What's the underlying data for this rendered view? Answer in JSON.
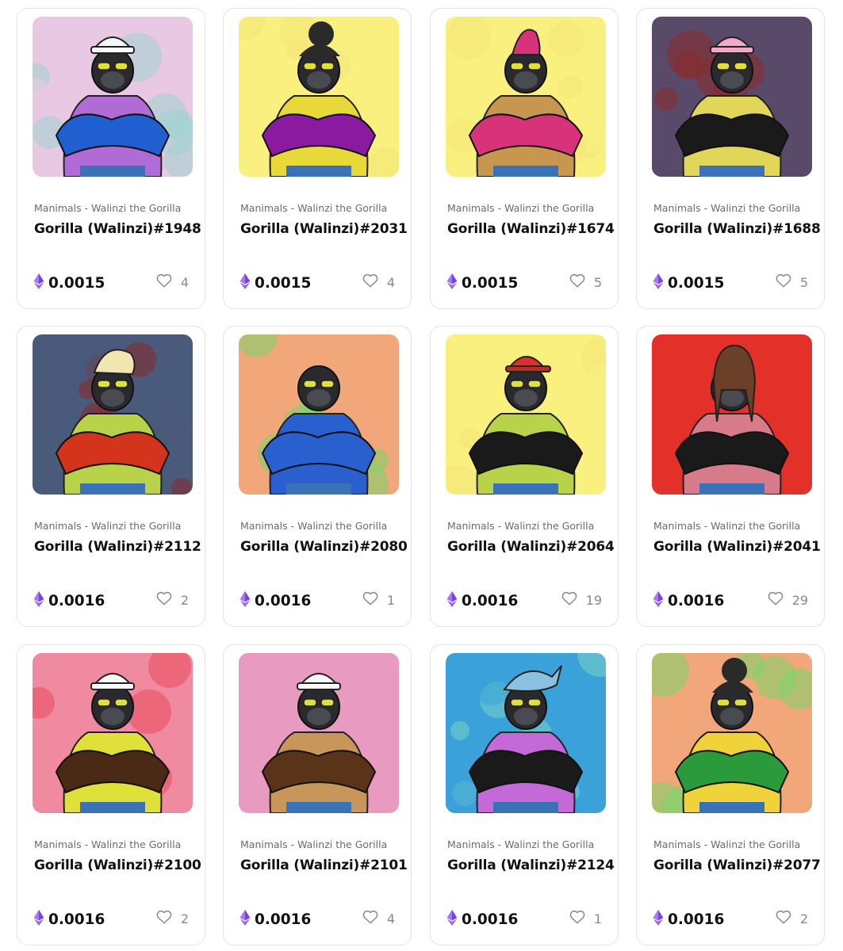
{
  "eth_color": "#7b3fe4",
  "items": [
    {
      "collection": "Manimals - Walinzi the Gorilla",
      "name": "Gorilla (Walinzi)#1948",
      "price": "0.0015",
      "likes": "4",
      "bg": "#e9c8e4",
      "bg2": "#9fd3d0",
      "fur": "#1f5fcf",
      "accent": "#b06bd6",
      "hat": "sailor"
    },
    {
      "collection": "Manimals - Walinzi the Gorilla",
      "name": "Gorilla (Walinzi)#2031",
      "price": "0.0015",
      "likes": "4",
      "bg": "#f9f07f",
      "bg2": "#f4e678",
      "fur": "#8a1aa0",
      "accent": "#e8d83a",
      "hat": "bun"
    },
    {
      "collection": "Manimals - Walinzi the Gorilla",
      "name": "Gorilla (Walinzi)#1674",
      "price": "0.0015",
      "likes": "5",
      "bg": "#f9f07f",
      "bg2": "#f4e678",
      "fur": "#d8327a",
      "accent": "#c8964e",
      "hat": "mohawk"
    },
    {
      "collection": "Manimals - Walinzi the Gorilla",
      "name": "Gorilla (Walinzi)#1688",
      "price": "0.0015",
      "likes": "5",
      "bg": "#5a4a6a",
      "bg2": "#8a2a2a",
      "fur": "#1a1a1a",
      "accent": "#e1d65a",
      "hat": "sailor-pink"
    },
    {
      "collection": "Manimals - Walinzi the Gorilla",
      "name": "Gorilla (Walinzi)#2112",
      "price": "0.0016",
      "likes": "2",
      "bg": "#4a5a7a",
      "bg2": "#8a2a2a",
      "fur": "#d4341c",
      "accent": "#b8d24a",
      "hat": "blond"
    },
    {
      "collection": "Manimals - Walinzi the Gorilla",
      "name": "Gorilla (Walinzi)#2080",
      "price": "0.0016",
      "likes": "1",
      "bg": "#f1a77a",
      "bg2": "#7ad66a",
      "fur": "#2a5fcf",
      "accent": "#2a5fcf",
      "hat": "none"
    },
    {
      "collection": "Manimals - Walinzi the Gorilla",
      "name": "Gorilla (Walinzi)#2064",
      "price": "0.0016",
      "likes": "19",
      "bg": "#f9f07f",
      "bg2": "#f4e678",
      "fur": "#1a1a1a",
      "accent": "#b8d24a",
      "hat": "cap"
    },
    {
      "collection": "Manimals - Walinzi the Gorilla",
      "name": "Gorilla (Walinzi)#2041",
      "price": "0.0016",
      "likes": "29",
      "bg": "#e3312a",
      "bg2": "#e3312a",
      "fur": "#1a1a1a",
      "accent": "#d77a8a",
      "hat": "long"
    },
    {
      "collection": "Manimals - Walinzi the Gorilla",
      "name": "Gorilla (Walinzi)#2100",
      "price": "0.0016",
      "likes": "2",
      "bg": "#f08aa0",
      "bg2": "#ea4a5a",
      "fur": "#4a2a14",
      "accent": "#e0e03a",
      "hat": "sailor"
    },
    {
      "collection": "Manimals - Walinzi the Gorilla",
      "name": "Gorilla (Walinzi)#2101",
      "price": "0.0016",
      "likes": "4",
      "bg": "#e89ac0",
      "bg2": "#e89ac0",
      "fur": "#5a3418",
      "accent": "#c8965a",
      "hat": "sailor"
    },
    {
      "collection": "Manimals - Walinzi the Gorilla",
      "name": "Gorilla (Walinzi)#2124",
      "price": "0.0016",
      "likes": "1",
      "bg": "#3aa2d8",
      "bg2": "#7ad0c8",
      "fur": "#1a1a1a",
      "accent": "#c46ad8",
      "hat": "shark"
    },
    {
      "collection": "Manimals - Walinzi the Gorilla",
      "name": "Gorilla (Walinzi)#2077",
      "price": "0.0016",
      "likes": "2",
      "bg": "#f1a77a",
      "bg2": "#7ad66a",
      "fur": "#2a9a3a",
      "accent": "#f0d23a",
      "hat": "bun"
    }
  ]
}
